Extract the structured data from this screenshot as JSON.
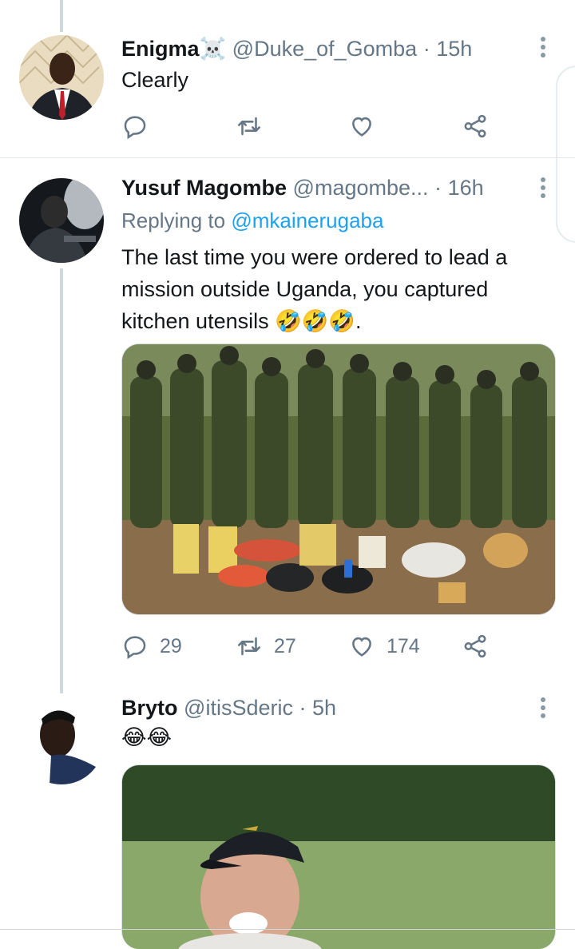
{
  "tweets": [
    {
      "name": "Enigma☠️",
      "handle": "@Duke_of_Gomba",
      "time": "15h",
      "text": "Clearly",
      "reply_count": "",
      "retweet_count": "",
      "like_count": ""
    },
    {
      "name": "Yusuf Magombe",
      "handle": "@magombe...",
      "time": "16h",
      "replying_prefix": "Replying to ",
      "replying_to": "@mkainerugaba",
      "text_line1": "The last time you were ordered to lead a",
      "text_line2": "mission outside Uganda,  you captured",
      "text_line3": "kitchen utensils 🤣🤣🤣.",
      "reply_count": "29",
      "retweet_count": "27",
      "like_count": "174"
    },
    {
      "name": "Bryto",
      "handle": "@itisSderic",
      "time": "5h",
      "text": "😂😂"
    }
  ],
  "colors": {
    "accent": "#1da1f2",
    "secondary": "#657786",
    "line": "#cfd9de"
  },
  "icons": [
    "reply-icon",
    "retweet-icon",
    "like-icon",
    "share-icon",
    "more-icon"
  ]
}
